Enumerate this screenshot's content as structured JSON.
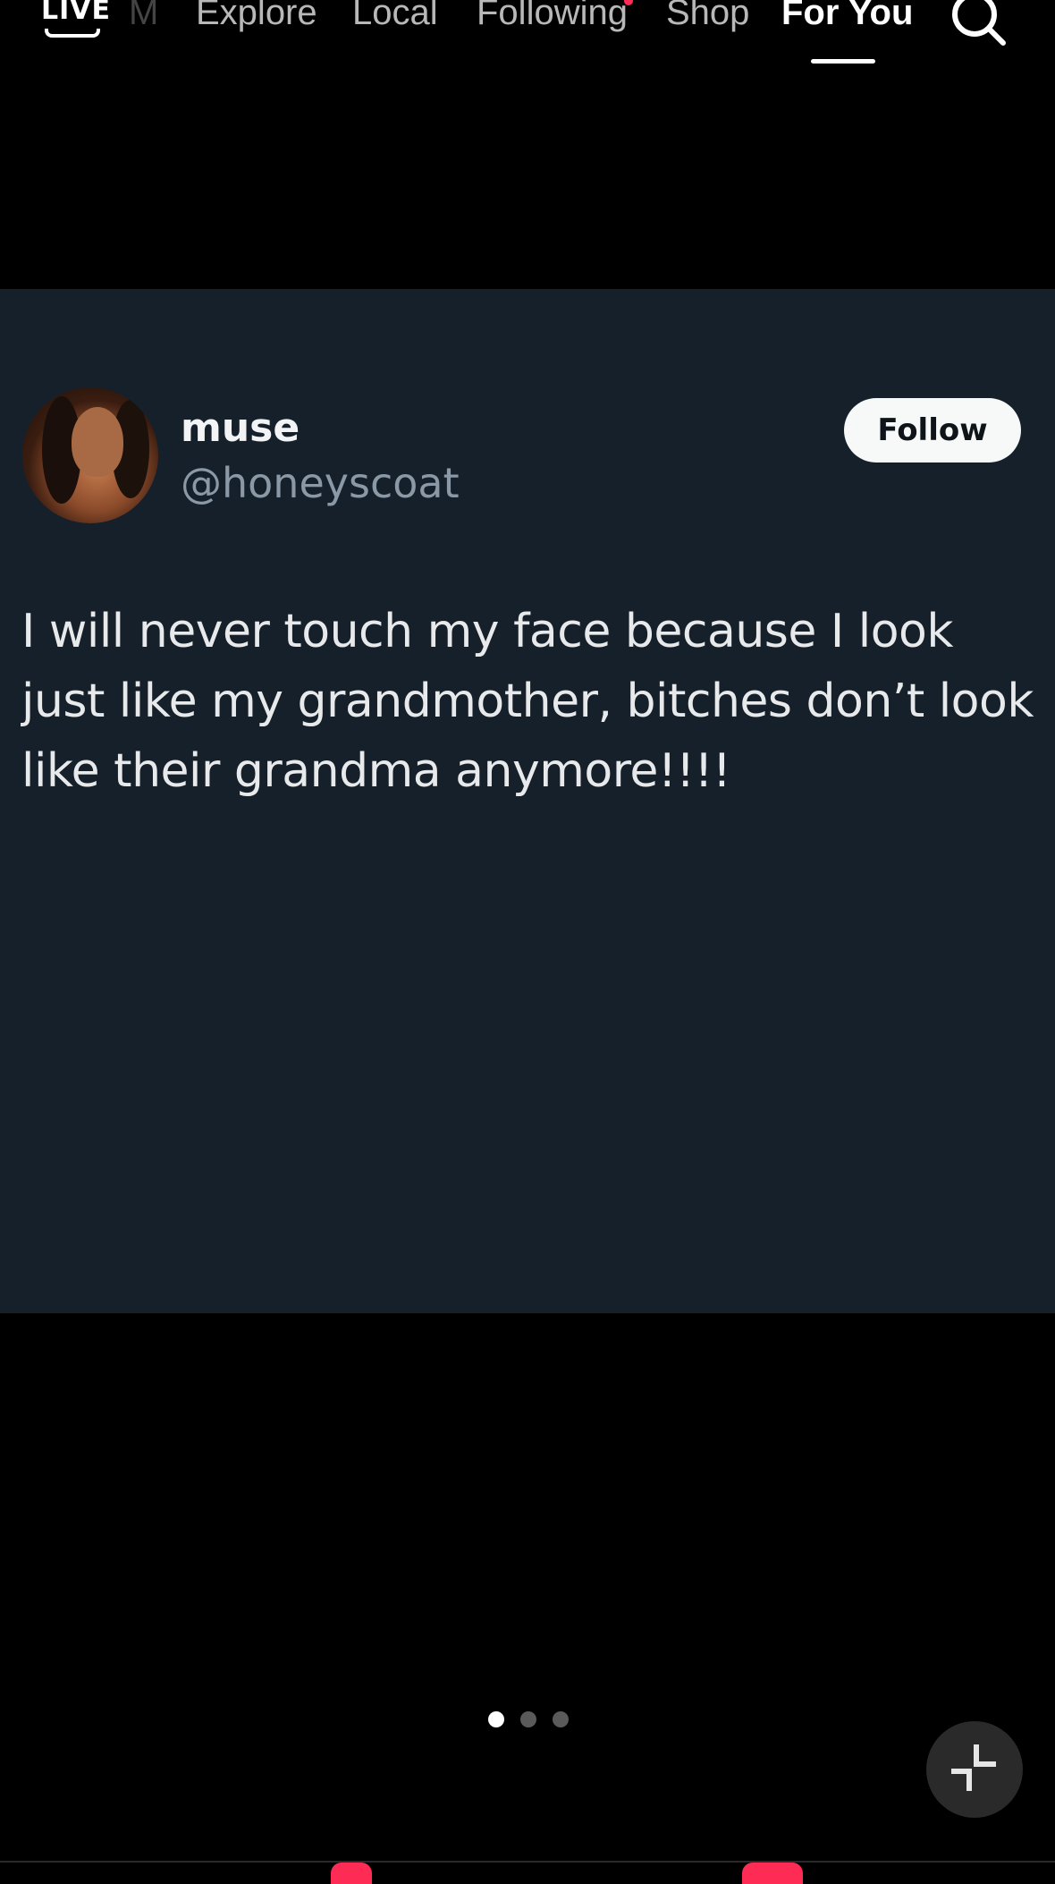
{
  "topnav": {
    "live_label": "LIVE",
    "faded_tab": "M",
    "tabs": [
      {
        "label": "Explore"
      },
      {
        "label": "Local"
      },
      {
        "label": "Following"
      },
      {
        "label": "Shop"
      },
      {
        "label": "For You"
      }
    ],
    "active_tab": "For You",
    "search_icon": "search-icon"
  },
  "post": {
    "display_name": "muse",
    "handle": "@honeyscoat",
    "follow_label": "Follow",
    "text": "I will never touch my face because I look just like my grandmother, bitches don’t look like their grandma anymore!!!!"
  },
  "pagination": {
    "count": 3,
    "active_index": 0
  },
  "controls": {
    "collapse_icon": "collapse-icon"
  },
  "colors": {
    "background": "#000000",
    "card": "#15202b",
    "accent": "#fe2c55",
    "handle_gray": "#8b98a5",
    "follow_button_bg": "#f7f9f9"
  }
}
